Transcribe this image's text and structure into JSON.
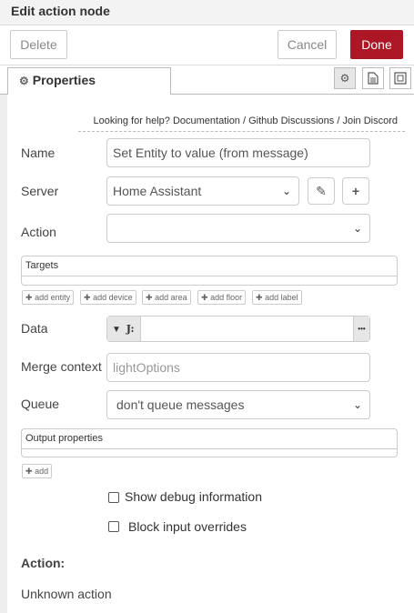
{
  "dialog": {
    "title": "Edit action node"
  },
  "actions": {
    "delete_label": "Delete",
    "cancel_label": "Cancel",
    "done_label": "Done"
  },
  "tabs": [
    {
      "label": "Properties",
      "icon": "gear-icon"
    }
  ],
  "tab_icons": [
    "gear-icon",
    "document-icon",
    "frame-icon"
  ],
  "help": {
    "prefix": "Looking for help?",
    "links": [
      "Documentation",
      "Github Discussions",
      "Join Discord"
    ],
    "separator": "/"
  },
  "form": {
    "name": {
      "label": "Name",
      "value": "Set Entity to value (from message)"
    },
    "server": {
      "label": "Server",
      "value": "Home Assistant"
    },
    "action": {
      "label": "Action",
      "value": ""
    },
    "targets": {
      "title": "Targets",
      "buttons": [
        "add entity",
        "add device",
        "add area",
        "add floor",
        "add label"
      ]
    },
    "data": {
      "label": "Data",
      "type_glyph": "J:",
      "value": "",
      "menu": "•••"
    },
    "merge_context": {
      "label": "Merge context",
      "placeholder": "lightOptions"
    },
    "queue": {
      "label": "Queue",
      "value": "don't queue messages"
    },
    "output_properties": {
      "title": "Output properties",
      "add_label": "add"
    },
    "show_debug": {
      "label": "Show debug information",
      "checked": false
    },
    "block_overrides": {
      "label": "Block input overrides",
      "checked": false
    }
  },
  "action_info": {
    "heading": "Action:",
    "text": "Unknown action"
  },
  "colors": {
    "accent": "#AD1625",
    "border": "#cccccc",
    "panel": "#f3f3f3"
  }
}
